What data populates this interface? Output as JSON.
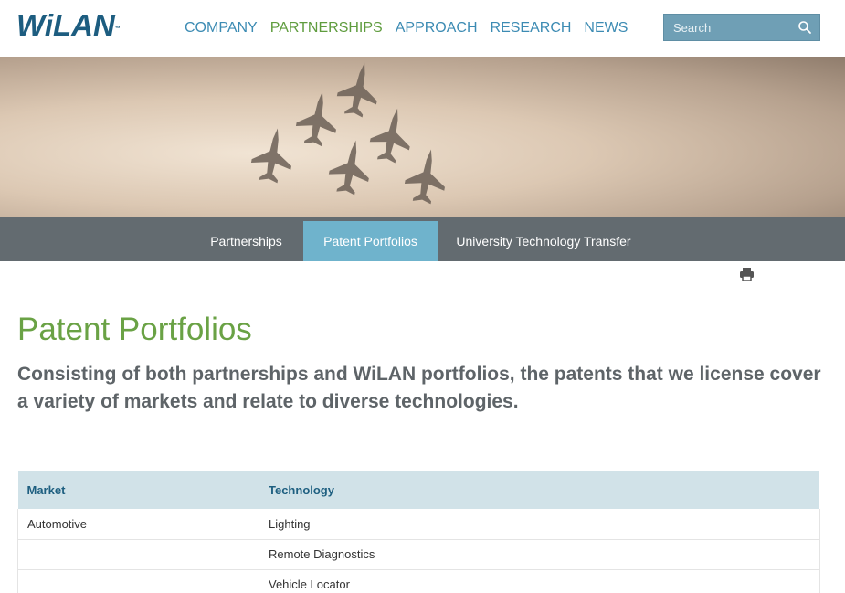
{
  "header": {
    "logo": "WiLAN",
    "logo_tm": "™",
    "nav": [
      "COMPANY",
      "PARTNERSHIPS",
      "APPROACH",
      "RESEARCH",
      "NEWS"
    ],
    "active_nav": "PARTNERSHIPS",
    "search_placeholder": "Search"
  },
  "subnav": {
    "tabs": [
      "Partnerships",
      "Patent Portfolios",
      "University Technology Transfer"
    ],
    "active": "Patent Portfolios"
  },
  "page": {
    "title": "Patent Portfolios",
    "intro": "Consisting of both partnerships and WiLAN portfolios, the patents that we license cover a variety of markets and relate to diverse technologies."
  },
  "table": {
    "headers": [
      "Market",
      "Technology"
    ],
    "rows": [
      [
        "Automotive",
        "Lighting"
      ],
      [
        "",
        "Remote Diagnostics"
      ],
      [
        "",
        "Vehicle Locator"
      ]
    ]
  },
  "colors": {
    "brand": "#1d5d80",
    "nav_link": "#3c8bb3",
    "active_green": "#6aa245",
    "subnav_bg": "#636b70",
    "subnav_active": "#6fb3cc"
  },
  "icons": {
    "search": "magnifier-icon",
    "print": "printer-icon"
  }
}
